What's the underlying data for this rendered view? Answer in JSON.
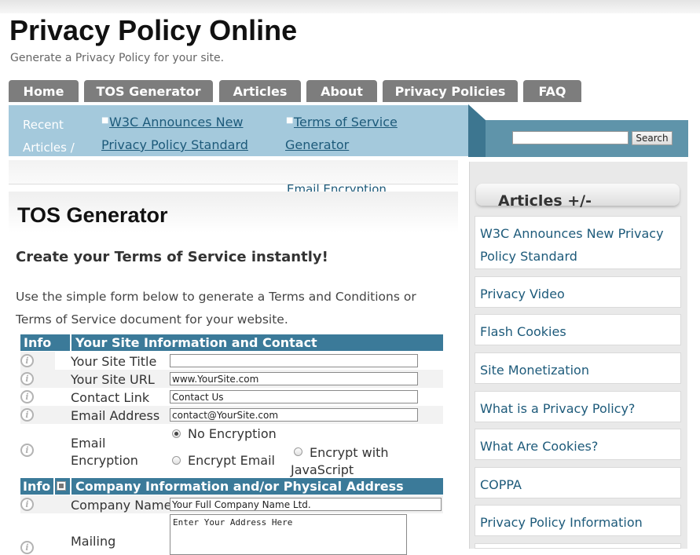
{
  "site": {
    "title": "Privacy Policy Online",
    "description": "Generate a Privacy Policy for your site."
  },
  "nav": {
    "tabs": [
      "Home",
      "TOS Generator",
      "Articles",
      "About",
      "Privacy Policies",
      "FAQ"
    ]
  },
  "ticker": {
    "label": "Recent Articles /",
    "items": [
      "W3C Announces New Privacy Policy Standard",
      "Terms of Service Generator",
      "Email Encryption"
    ]
  },
  "search": {
    "value": "",
    "button_label": "Search"
  },
  "page": {
    "title": "TOS Generator",
    "subtitle": "Create your Terms of Service instantly!",
    "intro": "Use the simple form below to generate a Terms and Conditions or Terms of Service document for your website."
  },
  "form": {
    "section1": {
      "info_header": "Info",
      "title": "Your Site Information and Contact"
    },
    "fields": {
      "site_title": {
        "label": "Your Site Title",
        "value": ""
      },
      "site_url": {
        "label": "Your Site URL",
        "value": "www.YourSite.com"
      },
      "contact_link": {
        "label": "Contact Link",
        "value": "Contact Us"
      },
      "email_address": {
        "label": "Email Address",
        "value": "contact@YourSite.com"
      },
      "email_encryption": {
        "label": "Email Encryption",
        "options": [
          "No Encryption",
          "Encrypt Email",
          "Encrypt with JavaScript"
        ],
        "selected": "No Encryption"
      },
      "company_name": {
        "label": "Company Name",
        "value": "Your Full Company Name Ltd."
      },
      "mailing": {
        "label": "Mailing",
        "value": "Enter Your Address Here"
      }
    },
    "section2": {
      "info_header": "Info",
      "title": "Company Information and/or Physical Address",
      "checked": true
    },
    "info_icon_glyph": "i"
  },
  "sidebar": {
    "widget_title": "Articles +/-",
    "items": [
      "W3C Announces New Privacy Policy Standard",
      "Privacy Video",
      "Flash Cookies",
      "Site Monetization",
      "What is a Privacy Policy?",
      "What Are Cookies?",
      "COPPA",
      "Privacy Policy Information"
    ]
  },
  "colors": {
    "nav_tab": "#7d7d7d",
    "ticker_bg": "#a4c9dc",
    "form_header": "#3b7a99",
    "link": "#1d5a7a",
    "sidebar_bg": "#e9e9e9"
  }
}
